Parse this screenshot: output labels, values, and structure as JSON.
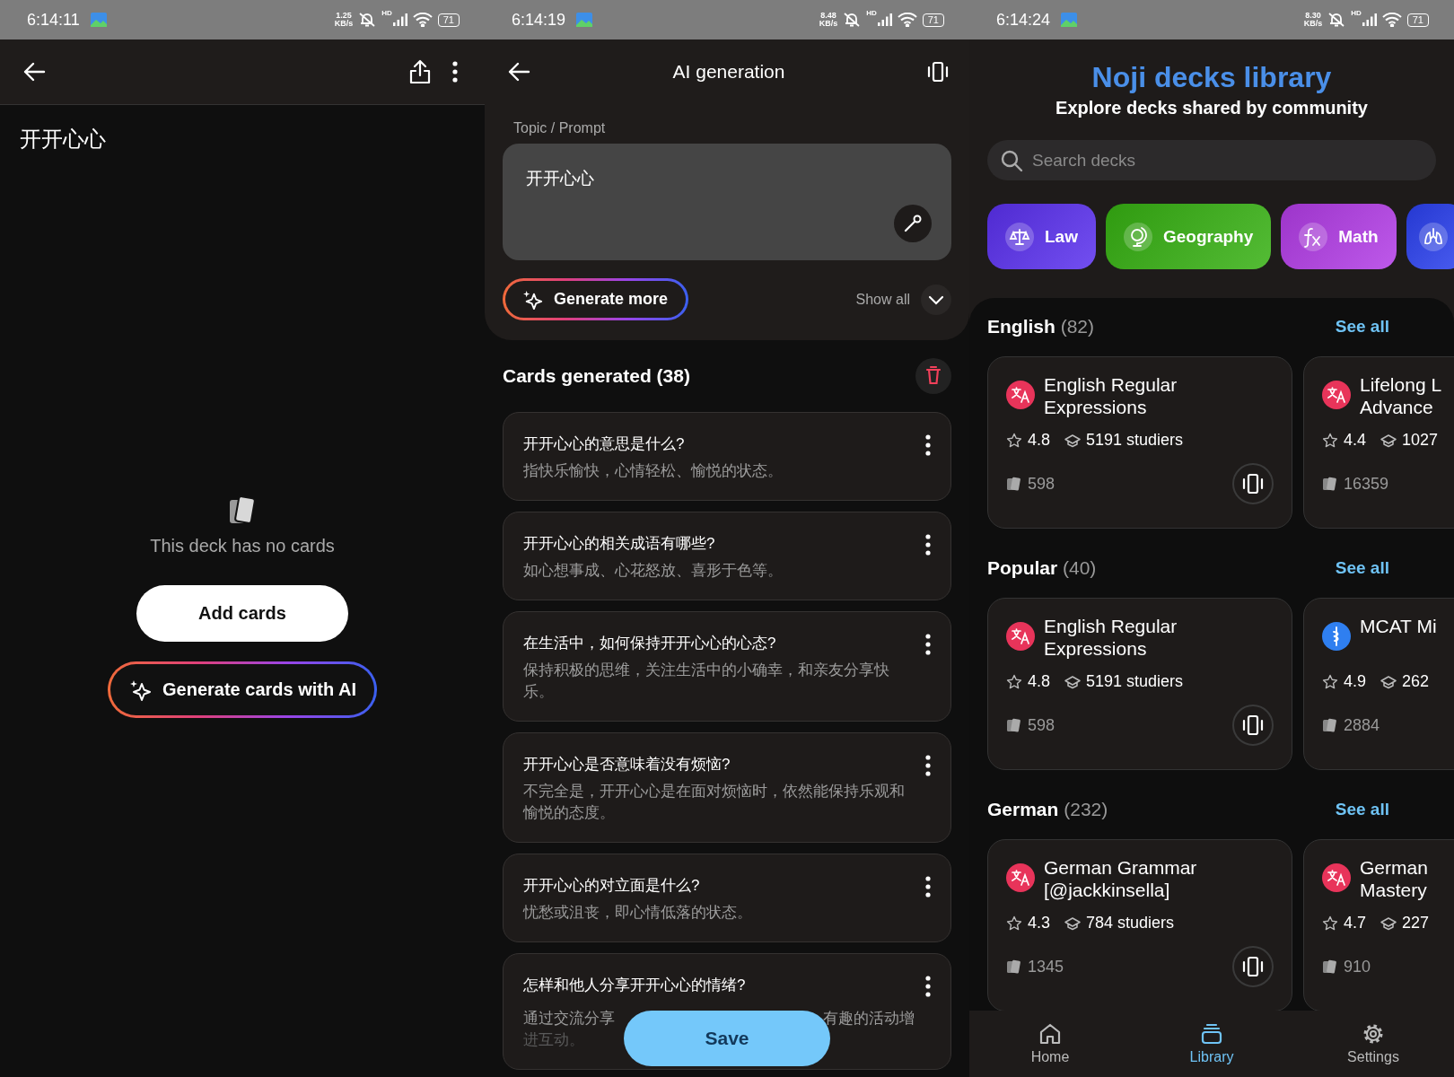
{
  "deck_screen": {
    "status_bar": {
      "time": "6:14:11",
      "speed": [
        "1.25",
        "KB/s"
      ],
      "hd": "HD",
      "battery": "71"
    },
    "title": "开开心心",
    "empty_message": "This deck has no cards",
    "add_button": "Add cards",
    "generate_button": "Generate cards with AI"
  },
  "ai_generation_screen": {
    "status_bar": {
      "time": "6:14:19",
      "speed": [
        "8.48",
        "KB/s"
      ],
      "hd": "HD",
      "battery": "71"
    },
    "title": "AI generation",
    "prompt_label": "Topic / Prompt",
    "prompt_value": "开开心心",
    "generate_more": "Generate more",
    "show_all": "Show all",
    "cards_heading": "Cards generated (38)",
    "cards": [
      {
        "question": "开开心心的意思是什么?",
        "answer": "指快乐愉快，心情轻松、愉悦的状态。"
      },
      {
        "question": "开开心心的相关成语有哪些?",
        "answer": "如心想事成、心花怒放、喜形于色等。"
      },
      {
        "question": "在生活中，如何保持开开心心的心态?",
        "answer": "保持积极的思维，关注生活中的小确幸，和亲友分享快乐。"
      },
      {
        "question": "开开心心是否意味着没有烦恼?",
        "answer": "不完全是，开开心心是在面对烦恼时，依然能保持乐观和愉悦的态度。"
      },
      {
        "question": "开开心心的对立面是什么?",
        "answer": "忧愁或沮丧，即心情低落的状态。"
      },
      {
        "question": "怎样和他人分享开开心心的情绪?",
        "answer_fragments": [
          "通过交流分享",
          "有趣的活动增",
          "进互动。"
        ]
      }
    ],
    "save_button": "Save"
  },
  "library_screen": {
    "status_bar": {
      "time": "6:14:24",
      "speed": [
        "8.30",
        "KB/s"
      ],
      "hd": "HD",
      "battery": "71"
    },
    "title": "Noji decks library",
    "subtitle": "Explore decks shared by community",
    "search": {
      "placeholder": "Search decks"
    },
    "categories": [
      {
        "label": "Law",
        "kind": "scales",
        "color": "#5a30ee"
      },
      {
        "label": "Geography",
        "kind": "globe",
        "color": "#36b012"
      },
      {
        "label": "Math",
        "kind": "function",
        "color": "#b23ce6"
      },
      {
        "kind": "lungs",
        "color": "#2a40ee"
      }
    ],
    "sections": [
      {
        "name": "English",
        "count": "(82)",
        "see_all": "See all",
        "decks": [
          {
            "kind": "translate",
            "title_lines": [
              "English Regular",
              "Expressions"
            ],
            "rating": "4.8",
            "studiers": "5191 studiers",
            "cards": "598"
          },
          {
            "kind": "translate",
            "title_lines": [
              "Lifelong L",
              "Advance"
            ],
            "rating": "4.4",
            "studiers": "1027",
            "cards": "16359"
          }
        ]
      },
      {
        "name": "Popular",
        "count": "(40)",
        "see_all": "See all",
        "decks": [
          {
            "kind": "translate",
            "title_lines": [
              "English Regular",
              "Expressions"
            ],
            "rating": "4.8",
            "studiers": "5191 studiers",
            "cards": "598"
          },
          {
            "kind": "medical",
            "title_lines": [
              "MCAT Mi"
            ],
            "rating": "4.9",
            "studiers": "262",
            "cards": "2884"
          }
        ]
      },
      {
        "name": "German",
        "count": "(232)",
        "see_all": "See all",
        "decks": [
          {
            "kind": "translate",
            "title_lines": [
              "German Grammar",
              "[@jackkinsella]"
            ],
            "rating": "4.3",
            "studiers": "784 studiers",
            "cards": "1345"
          },
          {
            "kind": "translate",
            "title_lines": [
              "German",
              "Mastery"
            ],
            "rating": "4.7",
            "studiers": "227",
            "cards": "910"
          }
        ]
      }
    ],
    "nav": [
      {
        "label": "Home",
        "kind": "home",
        "selected": false
      },
      {
        "label": "Library",
        "kind": "library",
        "selected": true
      },
      {
        "label": "Settings",
        "kind": "settings",
        "selected": false
      }
    ]
  }
}
